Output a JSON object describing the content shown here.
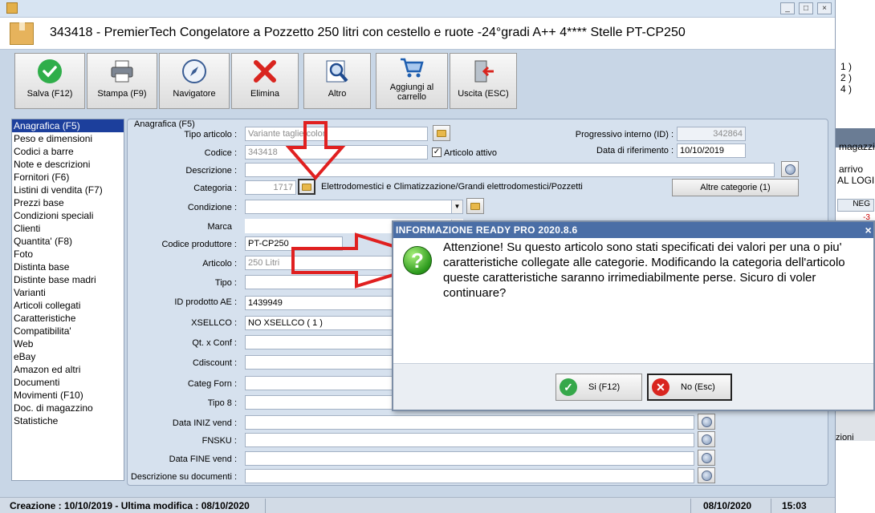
{
  "window": {
    "title": "343418 - PremierTech Congelatore a Pozzetto 250 litri con cestello e ruote -24°gradi A++ 4**** Stelle PT-CP250",
    "minimize": "_",
    "maximize": "□",
    "close": "×"
  },
  "background_window": {
    "lines": [
      "1 )",
      "2 )",
      "4 )"
    ],
    "text1": "magazzin",
    "text2": "arrivo",
    "text3": "AL LOGIS",
    "neg": "NEG",
    "neg_value": "-3",
    "bottom": "zioni"
  },
  "toolbar": {
    "save": "Salva (F12)",
    "print": "Stampa (F9)",
    "nav": "Navigatore",
    "delete": "Elimina",
    "other": "Altro",
    "cart_l1": "Aggiungi al",
    "cart_l2": "carrello",
    "exit": "Uscita (ESC)"
  },
  "sidebar": {
    "items": [
      "Anagrafica (F5)",
      "Peso e dimensioni",
      "Codici a barre",
      "Note e descrizioni",
      "Fornitori (F6)",
      "Listini di vendita (F7)",
      "Prezzi base",
      "Condizioni speciali",
      "Clienti",
      "Quantita' (F8)",
      "Foto",
      "Distinta base",
      "Distinte base madri",
      "Varianti",
      "Articoli collegati",
      "Caratteristiche",
      "Compatibilita'",
      "Web",
      "eBay",
      "Amazon ed altri",
      "Documenti",
      "Movimenti (F10)",
      "Doc. di magazzino",
      "Statistiche"
    ]
  },
  "form": {
    "panel_title": "Anagrafica (F5)",
    "tipo_articolo": {
      "label": "Tipo articolo :",
      "value": "Variante taglie/colori"
    },
    "codice": {
      "label": "Codice :",
      "value": "343418"
    },
    "articolo_attivo": {
      "label": "Articolo attivo",
      "checked": "✓"
    },
    "progressivo": {
      "label": "Progressivo interno (ID) :",
      "value": "342864"
    },
    "data_rif": {
      "label": "Data di riferimento :",
      "value": "10/10/2019"
    },
    "descrizione": {
      "label": "Descrizione :"
    },
    "categoria": {
      "label": "Categoria :",
      "id": "1717",
      "path": "Elettrodomestici e Climatizzazione/Grandi elettrodomestici/Pozzetti"
    },
    "altre_categorie": "Altre categorie (1)",
    "condizione": {
      "label": "Condizione :"
    },
    "marca": {
      "label": "Marca"
    },
    "codice_produttore": {
      "label": "Codice produttore :",
      "value": "PT-CP250"
    },
    "articolo": {
      "label": "Articolo :",
      "value": "250 Litri"
    },
    "tipo": {
      "label": "Tipo :"
    },
    "id_prodotto_ae": {
      "label": "ID prodotto AE :",
      "value": "1439949"
    },
    "xsellco": {
      "label": "XSELLCO :",
      "value": "NO XSELLCO ( 1 )"
    },
    "qt_conf": {
      "label": "Qt. x Conf :"
    },
    "cdiscount": {
      "label": "Cdiscount :"
    },
    "categ_forn": {
      "label": "Categ Forn :"
    },
    "tipo8": {
      "label": "Tipo 8 :"
    },
    "data_iniz": {
      "label": "Data INIZ vend :"
    },
    "fnsku": {
      "label": "FNSKU :"
    },
    "data_fine": {
      "label": "Data FINE vend :"
    },
    "desc_documenti": {
      "label": "Descrizione su documenti :"
    }
  },
  "status": {
    "created": "Creazione : 10/10/2019 - Ultima modifica : 08/10/2020",
    "date": "08/10/2020",
    "time": "15:03"
  },
  "dialog": {
    "title": "INFORMAZIONE READY PRO 2020.8.6",
    "close": "×",
    "icon": "?",
    "message": "Attenzione! Su questo articolo sono stati specificati dei valori per una o piu' caratteristiche collegate alle categorie. Modificando la categoria dell'articolo queste caratteristiche saranno irrimediabilmente perse. Sicuro di voler continuare?",
    "yes": "Si (F12)",
    "no": "No (Esc)",
    "yes_icon": "✓",
    "no_icon": "✕"
  },
  "colors": {
    "selection": "#1c3f9c",
    "dialog_title": "#4a6ea6",
    "arrow_red": "#e02020"
  }
}
